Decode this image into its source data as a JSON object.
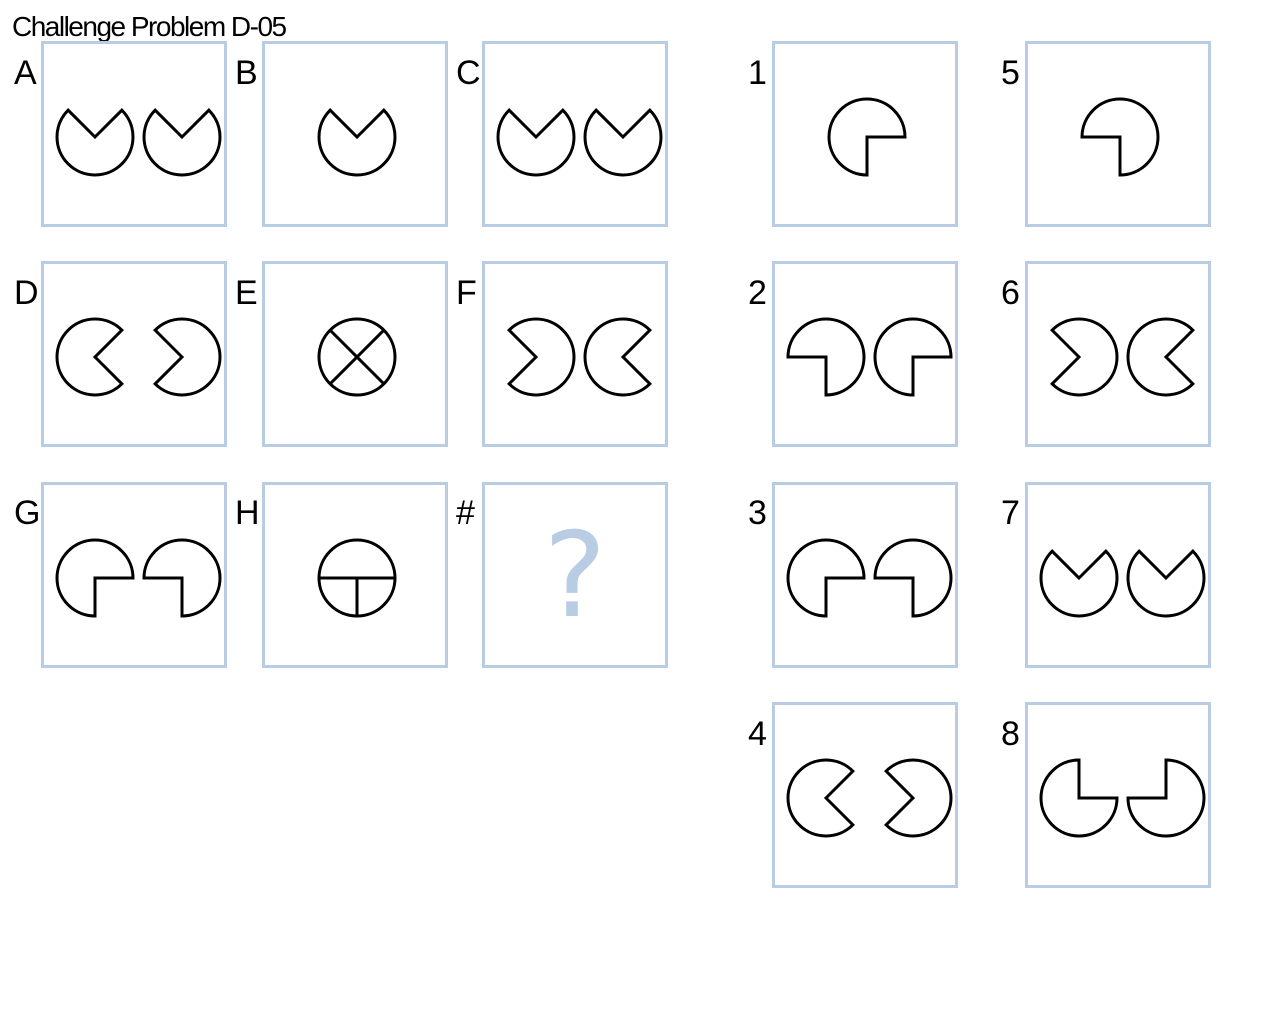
{
  "title": "Challenge Problem D-05",
  "colors": {
    "border": "#b8cde4",
    "stroke": "#000000",
    "question_mark": "#b8cde4"
  },
  "matrix": [
    {
      "id": "A",
      "label": "A",
      "shapes": [
        {
          "type": "pac",
          "dir": "up"
        },
        {
          "type": "pac",
          "dir": "up"
        }
      ]
    },
    {
      "id": "B",
      "label": "B",
      "shapes": [
        {
          "type": "pac",
          "dir": "up"
        }
      ]
    },
    {
      "id": "C",
      "label": "C",
      "shapes": [
        {
          "type": "pac",
          "dir": "up"
        },
        {
          "type": "pac",
          "dir": "up"
        }
      ]
    },
    {
      "id": "D",
      "label": "D",
      "shapes": [
        {
          "type": "pac",
          "dir": "right"
        },
        {
          "type": "pac",
          "dir": "left"
        }
      ]
    },
    {
      "id": "E",
      "label": "E",
      "shapes": [
        {
          "type": "circle-x"
        }
      ]
    },
    {
      "id": "F",
      "label": "F",
      "shapes": [
        {
          "type": "pac",
          "dir": "left"
        },
        {
          "type": "pac",
          "dir": "right"
        }
      ]
    },
    {
      "id": "G",
      "label": "G",
      "shapes": [
        {
          "type": "quad",
          "missing": "br"
        },
        {
          "type": "quad",
          "missing": "bl"
        }
      ]
    },
    {
      "id": "H",
      "label": "H",
      "shapes": [
        {
          "type": "circle-t"
        }
      ]
    },
    {
      "id": "missing",
      "label": "#",
      "question": "?"
    }
  ],
  "answers": [
    {
      "id": "1",
      "label": "1",
      "shapes": [
        {
          "type": "quad",
          "missing": "br"
        }
      ]
    },
    {
      "id": "2",
      "label": "2",
      "shapes": [
        {
          "type": "quad",
          "missing": "bl"
        },
        {
          "type": "quad",
          "missing": "br"
        }
      ]
    },
    {
      "id": "3",
      "label": "3",
      "shapes": [
        {
          "type": "quad",
          "missing": "br"
        },
        {
          "type": "quad",
          "missing": "bl"
        }
      ]
    },
    {
      "id": "4",
      "label": "4",
      "shapes": [
        {
          "type": "pac",
          "dir": "right"
        },
        {
          "type": "pac",
          "dir": "left"
        }
      ]
    },
    {
      "id": "5",
      "label": "5",
      "shapes": [
        {
          "type": "quad",
          "missing": "bl"
        }
      ]
    },
    {
      "id": "6",
      "label": "6",
      "shapes": [
        {
          "type": "pac",
          "dir": "left"
        },
        {
          "type": "pac",
          "dir": "right"
        }
      ]
    },
    {
      "id": "7",
      "label": "7",
      "shapes": [
        {
          "type": "pac",
          "dir": "up"
        },
        {
          "type": "pac",
          "dir": "up"
        }
      ]
    },
    {
      "id": "8",
      "label": "8",
      "shapes": [
        {
          "type": "quad",
          "missing": "tr"
        },
        {
          "type": "quad",
          "missing": "tl"
        }
      ]
    }
  ]
}
